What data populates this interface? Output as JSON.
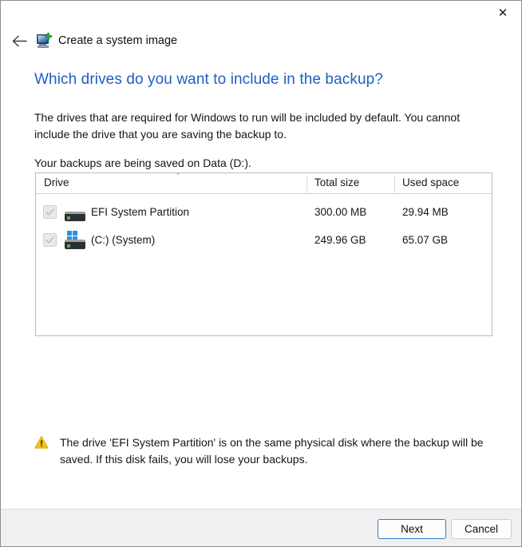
{
  "window": {
    "close_label": "✕",
    "close_icon": "close-icon"
  },
  "nav": {
    "back_icon": "back-arrow-icon",
    "app_icon": "create-system-image-icon",
    "app_title": "Create a system image"
  },
  "page": {
    "headline": "Which drives do you want to include in the backup?",
    "description": "The drives that are required for Windows to run will be included by default. You cannot include the drive that you are saving the backup to.",
    "saved_location": "Your backups are being saved on Data (D:)."
  },
  "drive_table": {
    "columns": [
      "Drive",
      "Total size",
      "Used space"
    ],
    "sort_indicator": "˄",
    "rows": [
      {
        "checked": "true",
        "enabled": "false",
        "icon": "hard-drive-icon",
        "label": "EFI System Partition",
        "total_size": "300.00 MB",
        "used_space": "29.94 MB"
      },
      {
        "checked": "true",
        "enabled": "false",
        "icon": "windows-system-drive-icon",
        "label": "(C:) (System)",
        "total_size": "249.96 GB",
        "used_space": "65.07 GB"
      }
    ]
  },
  "warning": {
    "icon": "warning-triangle-icon",
    "text": "The drive 'EFI System Partition' is on the same physical disk where the backup will be saved. If this disk fails, you will lose your backups."
  },
  "footer": {
    "next_label": "Next",
    "cancel_label": "Cancel"
  },
  "colors": {
    "headline": "#1f5fbf",
    "accent_button_border": "#2f7fd0",
    "warning": "#f0b400",
    "footer_bg": "#f0f0f0"
  }
}
